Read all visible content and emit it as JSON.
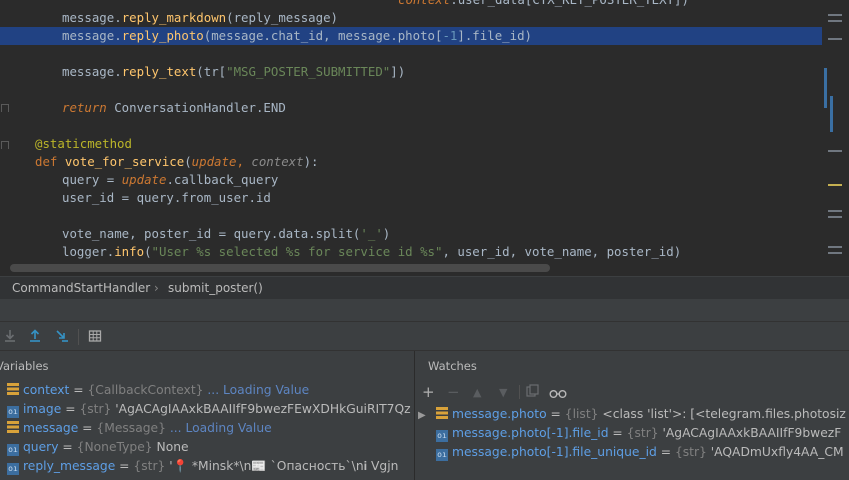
{
  "editor": {
    "lines": [
      {
        "id": "l0",
        "tokens": [
          [
            "ctxp",
            "context"
          ],
          [
            "",
            "."
          ],
          [
            "",
            "user_data[CTX_KEY_POSTER_TEXT]"
          ],
          [
            "",
            ")"
          ]
        ]
      },
      {
        "id": "l1",
        "tokens": [
          [
            "",
            "message."
          ],
          [
            "fn",
            "reply_markdown"
          ],
          [
            "",
            "(reply_message)"
          ]
        ]
      },
      {
        "id": "l2",
        "tokens": [
          [
            "",
            "message."
          ],
          [
            "fn",
            "reply_photo"
          ],
          [
            "",
            "(message.chat_id, message.photo["
          ],
          [
            "num",
            "-1"
          ],
          [
            "",
            "].file_id)"
          ]
        ]
      },
      {
        "id": "l3",
        "tokens": []
      },
      {
        "id": "l4",
        "tokens": [
          [
            "",
            "message."
          ],
          [
            "fn",
            "reply_text"
          ],
          [
            "",
            "(tr["
          ],
          [
            "str",
            "\"MSG_POSTER_SUBMITTED\""
          ],
          [
            "",
            "])"
          ]
        ]
      },
      {
        "id": "l5",
        "tokens": []
      },
      {
        "id": "l6",
        "tokens": [
          [
            "kwi",
            "return "
          ],
          [
            "",
            "ConversationHandler.END"
          ]
        ]
      },
      {
        "id": "l7",
        "tokens": []
      },
      {
        "id": "l8",
        "tokens": [
          [
            "dec",
            "@staticmethod"
          ]
        ]
      },
      {
        "id": "l9",
        "tokens": [
          [
            "kw",
            "def "
          ],
          [
            "fn",
            "vote_for_service"
          ],
          [
            "",
            "("
          ],
          [
            "ctxp",
            "update"
          ],
          [
            "kw",
            ", "
          ],
          [
            "param",
            "context"
          ],
          [
            "",
            "):"
          ]
        ]
      },
      {
        "id": "l10",
        "tokens": [
          [
            "",
            "query = "
          ],
          [
            "ctxp",
            "update"
          ],
          [
            "",
            ".callback_query"
          ]
        ]
      },
      {
        "id": "l11",
        "tokens": [
          [
            "",
            "user_id = query.from_user.id"
          ]
        ]
      },
      {
        "id": "l12",
        "tokens": []
      },
      {
        "id": "l13",
        "tokens": [
          [
            "",
            "vote_name, poster_id = query.data.split("
          ],
          [
            "str",
            "'_'"
          ],
          [
            "",
            ")"
          ]
        ]
      },
      {
        "id": "l14",
        "tokens": [
          [
            "",
            "logger."
          ],
          [
            "fn",
            "info"
          ],
          [
            "",
            "("
          ],
          [
            "str",
            "\"User %s selected %s for service id %s\""
          ],
          [
            "",
            ", user_id, vote_name, poster_id)"
          ]
        ]
      }
    ]
  },
  "breadcrumb": {
    "class_name": "CommandStartHandler",
    "separator": "›",
    "method_name": "submit_poster()"
  },
  "variables": {
    "title": "Variables",
    "rows": [
      {
        "icon": "list",
        "name": "context",
        "eq": " = ",
        "type": "{CallbackContext}",
        "loading": " ... Loading Value",
        "value": ""
      },
      {
        "icon": "object",
        "name": "image",
        "eq": " = ",
        "type": "{str}",
        "loading": "",
        "value": " 'AgACAgIAAxkBAAIIfF9bwezFEwXDHkGuiRIT7Qz"
      },
      {
        "icon": "list",
        "name": "message",
        "eq": " = ",
        "type": "{Message}",
        "loading": " ... Loading Value",
        "value": ""
      },
      {
        "icon": "object",
        "name": "query",
        "eq": " = ",
        "type": "{NoneType}",
        "loading": "",
        "value": " None"
      },
      {
        "icon": "object",
        "name": "reply_message",
        "eq": " = ",
        "type": "{str}",
        "loading": "",
        "value": " '📍 *Minsk*\\n📰 `Опасность`\\n𝐢 Vgjn"
      }
    ]
  },
  "watches": {
    "title": "Watches",
    "rows": [
      {
        "icon": "list",
        "expandable": true,
        "name": "message.photo",
        "eq": " = ",
        "type": "{list}",
        "value": " <class 'list'>: [<telegram.files.photosiz"
      },
      {
        "icon": "object",
        "expandable": false,
        "name": "message.photo[-1].file_id",
        "eq": " = ",
        "type": "{str}",
        "value": " 'AgACAgIAAxkBAAIIfF9bwezF"
      },
      {
        "icon": "object",
        "expandable": false,
        "name": "message.photo[-1].file_unique_id",
        "eq": " = ",
        "type": "{str}",
        "value": " 'AQADmUxfly4AA_CM"
      }
    ]
  },
  "toolbar_icons": [
    "download-icon",
    "upload-icon",
    "step-icon",
    "table-icon"
  ],
  "watch_toolbar_icons": [
    "plus-icon",
    "minus-icon",
    "arrow-up-icon",
    "arrow-down-icon",
    "copy-icon",
    "glasses-icon"
  ]
}
